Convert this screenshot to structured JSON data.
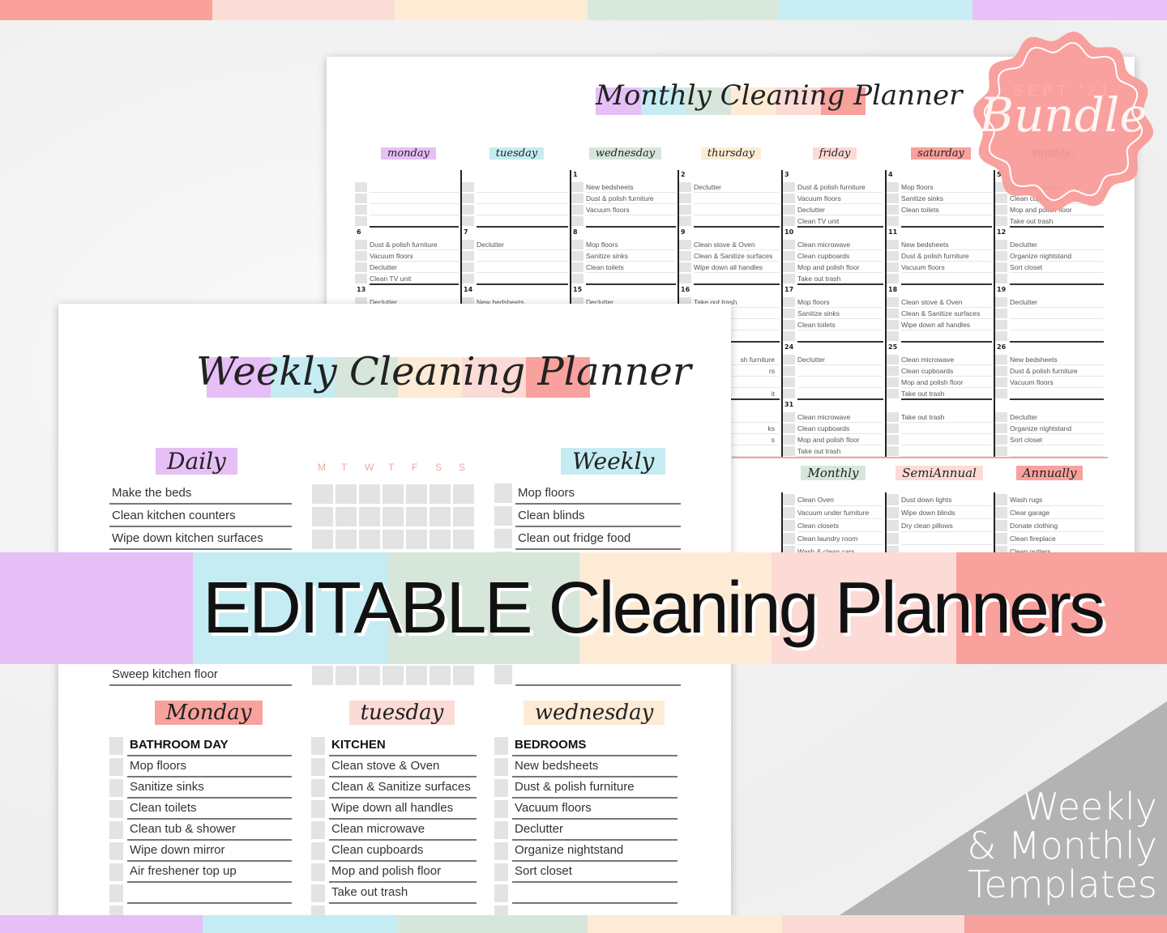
{
  "colors": {
    "purple": "#e6bff7",
    "blue": "#c5ecf2",
    "green": "#d6e6db",
    "peach": "#fdebd5",
    "pink": "#fcdad5",
    "red": "#f9a19c",
    "stamp": "#f99a97",
    "triangle": "#b3b3b3"
  },
  "banner": {
    "text": "EDITABLE Cleaning Planners"
  },
  "stamp": {
    "text": "Bundle",
    "month": "SEPT '21"
  },
  "corner": {
    "line1": "Weekly",
    "line2": "& Monthly",
    "line3": "Templates"
  },
  "monthly": {
    "title": "Monthly Cleaning Planner",
    "days": [
      "monday",
      "tuesday",
      "wednesday",
      "thursday",
      "friday",
      "saturday",
      "sunday"
    ],
    "weeks": [
      [
        {
          "date": "",
          "items": []
        },
        {
          "date": "",
          "items": []
        },
        {
          "date": "1",
          "items": [
            "New bedsheets",
            "Dust & polish furniture",
            "Vacuum floors"
          ]
        },
        {
          "date": "2",
          "items": [
            "Declutter"
          ]
        },
        {
          "date": "3",
          "items": [
            "Dust & polish furniture",
            "Vacuum floors",
            "Declutter",
            "Clean TV unit"
          ]
        },
        {
          "date": "4",
          "items": [
            "Mop floors",
            "Sanitize sinks",
            "Clean toilets"
          ]
        },
        {
          "date": "5",
          "items": [
            "Clean microwave",
            "Clean cupboards",
            "Mop and polish floor",
            "Take out trash"
          ]
        }
      ],
      [
        {
          "date": "6",
          "items": [
            "Dust & polish furniture",
            "Vacuum floors",
            "Declutter",
            "Clean TV unit"
          ]
        },
        {
          "date": "7",
          "items": [
            "Declutter"
          ]
        },
        {
          "date": "8",
          "items": [
            "Mop floors",
            "Sanitize sinks",
            "Clean toilets"
          ]
        },
        {
          "date": "9",
          "items": [
            "Clean stove & Oven",
            "Clean & Sanitize surfaces",
            "Wipe down all handles"
          ]
        },
        {
          "date": "10",
          "items": [
            "Clean microwave",
            "Clean cupboards",
            "Mop and polish floor",
            "Take out trash"
          ]
        },
        {
          "date": "11",
          "items": [
            "New bedsheets",
            "Dust & polish furniture",
            "Vacuum floors"
          ]
        },
        {
          "date": "12",
          "items": [
            "Declutter",
            "Organize nightstand",
            "Sort closet"
          ]
        }
      ],
      [
        {
          "date": "13",
          "items": [
            "Declutter"
          ]
        },
        {
          "date": "14",
          "items": [
            "New bedsheets"
          ]
        },
        {
          "date": "15",
          "items": [
            "Declutter"
          ]
        },
        {
          "date": "16",
          "items": [
            "Take out trash"
          ]
        },
        {
          "date": "17",
          "items": [
            "Mop floors",
            "Sanitize sinks",
            "Clean toilets"
          ]
        },
        {
          "date": "18",
          "items": [
            "Clean stove & Oven",
            "Clean & Sanitize surfaces",
            "Wipe down all handles"
          ]
        },
        {
          "date": "19",
          "items": [
            "Declutter"
          ]
        }
      ],
      [
        {
          "date": "",
          "items": []
        },
        {
          "date": "",
          "items": []
        },
        {
          "date": "",
          "items": []
        },
        {
          "date": "",
          "items": [
            "sh furniture",
            "rs",
            "",
            "it"
          ]
        },
        {
          "date": "24",
          "items": [
            "Declutter"
          ]
        },
        {
          "date": "25",
          "items": [
            "Clean microwave",
            "Clean cupboards",
            "Mop and polish floor",
            "Take out trash"
          ]
        },
        {
          "date": "26",
          "items": [
            "New bedsheets",
            "Dust & polish furniture",
            "Vacuum floors"
          ]
        }
      ],
      [
        {
          "date": "",
          "items": []
        },
        {
          "date": "",
          "items": []
        },
        {
          "date": "",
          "items": []
        },
        {
          "date": "",
          "items": [
            "",
            "ks",
            "s"
          ]
        },
        {
          "date": "31",
          "items": [
            "Clean microwave",
            "Clean cupboards",
            "Mop and polish floor",
            "Take out trash"
          ]
        },
        {
          "date": "",
          "items": [
            "Take out trash"
          ]
        },
        {
          "date": "",
          "items": [
            "Declutter",
            "Organize nightstand",
            "Sort closet"
          ]
        }
      ]
    ],
    "sections": [
      {
        "title": "Monthly",
        "items": [
          "Clean Oven",
          "Vacuum under furniture",
          "Clean closets",
          "Clean laundry room",
          "Wash & clean cars"
        ]
      },
      {
        "title": "SemiAnnual",
        "items": [
          "Dust down lights",
          "Wipe down blinds",
          "Dry clean pillows"
        ]
      },
      {
        "title": "Annually",
        "items": [
          "Wash rugs",
          "Clear garage",
          "Donate clothing",
          "Clean fireplace",
          "Clean gutters"
        ]
      }
    ]
  },
  "weekly": {
    "title": "Weekly Cleaning Planner",
    "daily": {
      "title": "Daily",
      "items": [
        "Make the beds",
        "Clean kitchen counters",
        "Wipe down kitchen surfaces",
        "",
        "",
        "",
        "",
        "",
        "Sweep kitchen floor"
      ]
    },
    "tracker_days": [
      "M",
      "T",
      "W",
      "T",
      "F",
      "S",
      "S"
    ],
    "weekly": {
      "title": "Weekly",
      "items": [
        "Mop floors",
        "Clean blinds",
        "Clean out fridge food",
        "",
        "",
        "",
        "",
        "",
        ""
      ]
    },
    "days": [
      {
        "title": "Monday",
        "items": [
          "BATHROOM DAY",
          "Mop floors",
          "Sanitize sinks",
          "Clean toilets",
          "Clean tub & shower",
          "Wipe down mirror",
          "Air freshener top up",
          ""
        ]
      },
      {
        "title": "tuesday",
        "items": [
          "KITCHEN",
          "Clean stove & Oven",
          "Clean & Sanitize surfaces",
          "Wipe down all handles",
          "Clean microwave",
          "Clean cupboards",
          "Mop and polish floor",
          "Take out trash"
        ]
      },
      {
        "title": "wednesday",
        "items": [
          "BEDROOMS",
          "New bedsheets",
          "Dust & polish furniture",
          "Vacuum floors",
          "Declutter",
          "Organize nightstand",
          "Sort closet",
          ""
        ]
      }
    ]
  }
}
